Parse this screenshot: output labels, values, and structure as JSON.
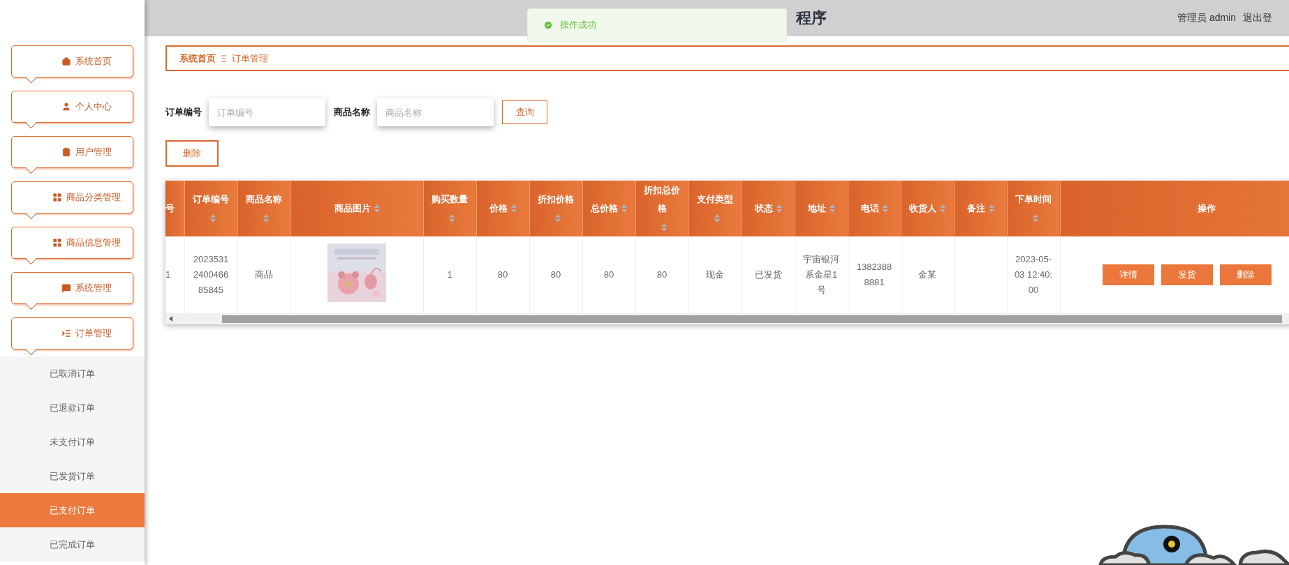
{
  "header": {
    "title": "程序",
    "user": "管理员 admin",
    "logout": "退出登"
  },
  "toast": {
    "message": "操作成功"
  },
  "sidebar": {
    "items": [
      {
        "label": "系统首页",
        "kind": "home"
      },
      {
        "label": "个人中心",
        "kind": "user"
      },
      {
        "label": "用户管理",
        "kind": "clipboard"
      },
      {
        "label": "商品分类管理",
        "kind": "grid"
      },
      {
        "label": "商品信息管理",
        "kind": "grid"
      },
      {
        "label": "系统管理",
        "kind": "message"
      },
      {
        "label": "订单管理",
        "kind": "list",
        "children": [
          {
            "label": "已取消订单",
            "selected": false
          },
          {
            "label": "已退款订单",
            "selected": false
          },
          {
            "label": "未支付订单",
            "selected": false
          },
          {
            "label": "已发货订单",
            "selected": false
          },
          {
            "label": "已支付订单",
            "selected": true
          },
          {
            "label": "已完成订单",
            "selected": false
          }
        ]
      }
    ]
  },
  "breadcrumb": [
    "系统首页",
    "订单管理"
  ],
  "filters": [
    {
      "label": "订单编号",
      "placeholder": "订单编号"
    },
    {
      "label": "商品名称",
      "placeholder": "商品名称"
    }
  ],
  "search_button": "查询",
  "delete_button": "删除",
  "table": {
    "columns": [
      {
        "label": "号",
        "sortable": false
      },
      {
        "label": "订单编号",
        "sortable": true
      },
      {
        "label": "商品名称",
        "sortable": true
      },
      {
        "label": "商品图片",
        "sortable": true
      },
      {
        "label": "购买数量",
        "sortable": true
      },
      {
        "label": "价格",
        "sortable": true
      },
      {
        "label": "折扣价格",
        "sortable": true
      },
      {
        "label": "总价格",
        "sortable": true
      },
      {
        "label": "折扣总价格",
        "sortable": true
      },
      {
        "label": "支付类型",
        "sortable": true
      },
      {
        "label": "状态",
        "sortable": true
      },
      {
        "label": "地址",
        "sortable": true
      },
      {
        "label": "电话",
        "sortable": true
      },
      {
        "label": "收货人",
        "sortable": true
      },
      {
        "label": "备注",
        "sortable": true
      },
      {
        "label": "下单时间",
        "sortable": true
      },
      {
        "label": "操作",
        "sortable": false
      }
    ],
    "rows": [
      {
        "cells": [
          {
            "kind": "text",
            "text": "1"
          },
          {
            "kind": "text",
            "text": "2023531240046685845"
          },
          {
            "kind": "text",
            "text": "商品"
          },
          {
            "kind": "picture"
          },
          {
            "kind": "text",
            "text": "1"
          },
          {
            "kind": "text",
            "text": "80"
          },
          {
            "kind": "text",
            "text": "80"
          },
          {
            "kind": "text",
            "text": "80"
          },
          {
            "kind": "text",
            "text": "80"
          },
          {
            "kind": "text",
            "text": "现金"
          },
          {
            "kind": "text",
            "text": "已发货"
          },
          {
            "kind": "text",
            "text": "宇宙银河系金星1号"
          },
          {
            "kind": "text",
            "text": "13823888881"
          },
          {
            "kind": "text",
            "text": "金某"
          },
          {
            "kind": "empty"
          },
          {
            "kind": "text",
            "text": "2023-05-03 12:40:00"
          }
        ],
        "actions": [
          "详情",
          "发货",
          "删除"
        ]
      }
    ]
  }
}
